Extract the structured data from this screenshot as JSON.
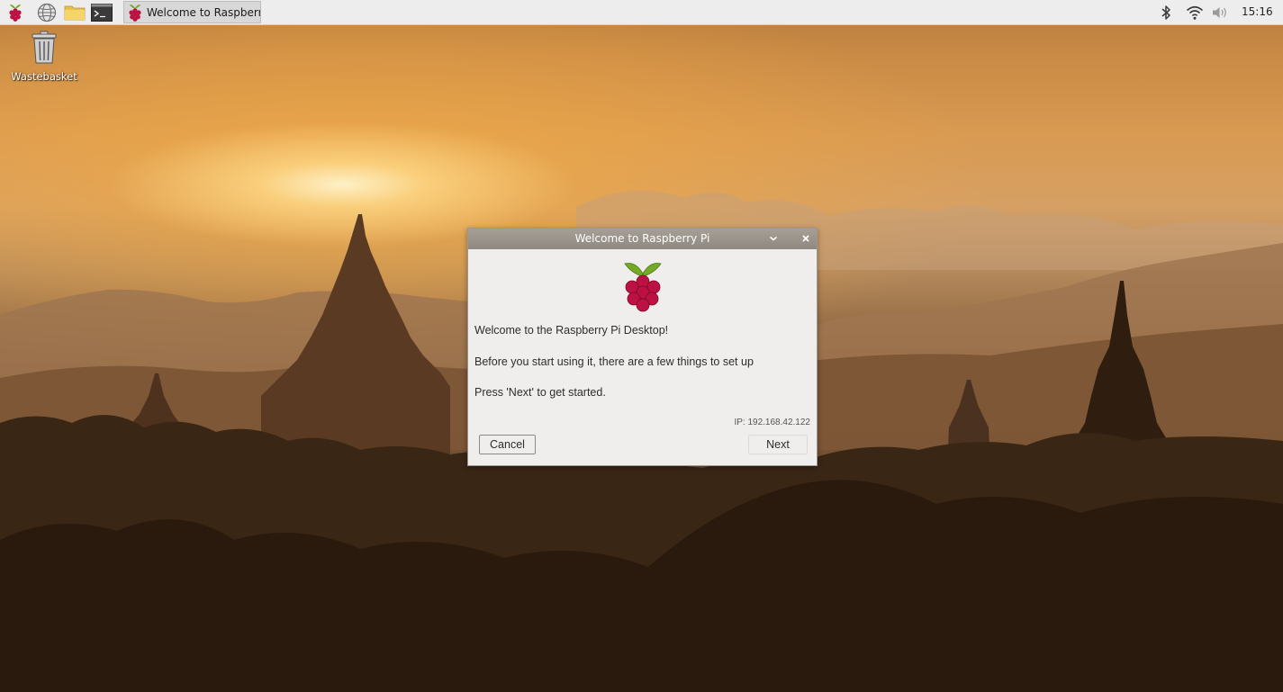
{
  "taskbar": {
    "launchers": [
      {
        "icon": "raspberry-menu-icon"
      },
      {
        "icon": "globe-browser-icon"
      },
      {
        "icon": "folder-icon"
      },
      {
        "icon": "terminal-icon"
      }
    ],
    "task_label": "Welcome to Raspberr...",
    "tray": {
      "bluetooth": "bluetooth-icon",
      "wifi": "wifi-icon",
      "volume": "volume-icon"
    },
    "clock": "15:16"
  },
  "desktop": {
    "icons": [
      {
        "label": "Wastebasket",
        "icon": "trash-icon"
      }
    ]
  },
  "dialog": {
    "title": "Welcome to Raspberry Pi",
    "titlebar_buttons": {
      "minimize": "chevron-down-icon",
      "close": "close-icon"
    },
    "welcome_line": "Welcome to the Raspberry Pi Desktop!",
    "setup_line": "Before you start using it, there are a few things to set up",
    "next_hint": "Press 'Next' to get started.",
    "ip": "IP: 192.168.42.122",
    "cancel_label": "Cancel",
    "next_label": "Next"
  },
  "colors": {
    "taskbar_bg": "#ededed",
    "titlebar_bg": "#9a948c",
    "dialog_bg": "#efeeec",
    "raspberry_red": "#bc1142",
    "raspberry_green": "#75a928"
  }
}
